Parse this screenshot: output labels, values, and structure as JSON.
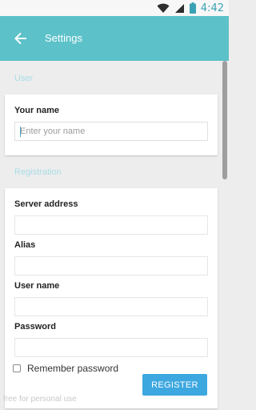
{
  "status_bar": {
    "time": "4:42",
    "icons": [
      "wifi-icon",
      "signal-icon",
      "battery-icon"
    ],
    "time_color": "#39a1b3"
  },
  "app_bar": {
    "title": "Settings",
    "back_icon": "arrow-left-icon",
    "color": "#5cc1c9"
  },
  "sections": {
    "user": {
      "label": "User",
      "fields": {
        "your_name": {
          "label": "Your name",
          "placeholder": "Enter your name",
          "value": ""
        }
      }
    },
    "registration": {
      "label": "Registration",
      "fields": {
        "server_address": {
          "label": "Server address",
          "value": ""
        },
        "alias": {
          "label": "Alias",
          "value": ""
        },
        "user_name": {
          "label": "User name",
          "value": ""
        },
        "password": {
          "label": "Password",
          "value": ""
        }
      },
      "remember_password": {
        "label": "Remember password",
        "checked": false
      },
      "register_button": "REGISTER",
      "button_color": "#3da7e0"
    }
  },
  "watermark": "free for personal use"
}
